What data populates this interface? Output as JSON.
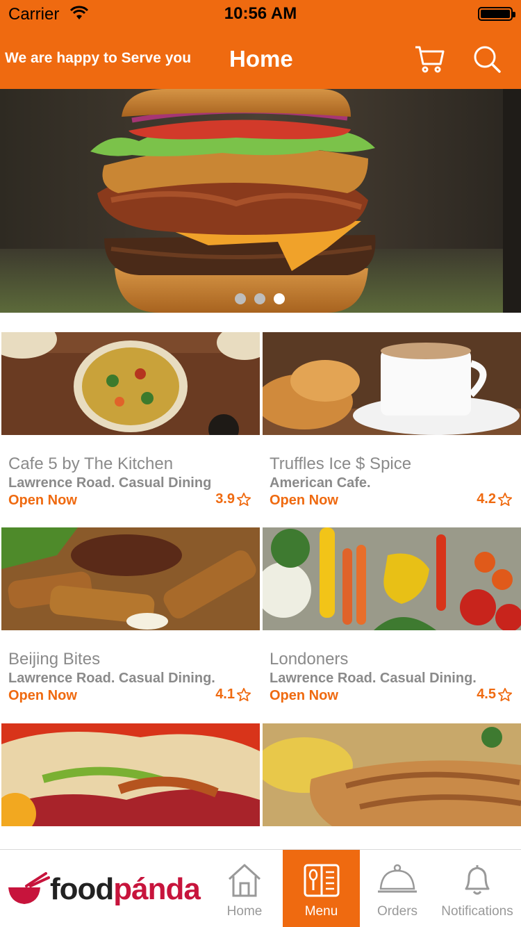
{
  "status_bar": {
    "carrier": "Carrier",
    "time": "10:56 AM"
  },
  "nav": {
    "tagline": "We are happy to Serve you",
    "title": "Home",
    "cart_icon": "cart-icon",
    "search_icon": "search-icon",
    "bg_color": "#ef6a10"
  },
  "banner": {
    "slides": 3,
    "active_slide": 3
  },
  "restaurants": [
    {
      "name": "Cafe 5 by The Kitchen",
      "subtitle": "Lawrence Road. Casual Dining",
      "status": "Open Now",
      "rating": "3.9"
    },
    {
      "name": "Truffles Ice $ Spice",
      "subtitle": "American Cafe.",
      "status": "Open Now",
      "rating": "4.2"
    },
    {
      "name": "Beijing Bites",
      "subtitle": "Lawrence Road. Casual Dining.",
      "status": "Open Now",
      "rating": "4.1"
    },
    {
      "name": "Londoners",
      "subtitle": "Lawrence Road. Casual Dining.",
      "status": "Open Now",
      "rating": "4.5"
    }
  ],
  "tab_bar": {
    "brand": {
      "part1": "food",
      "part2": "pánda"
    },
    "tabs": [
      {
        "label": "Home",
        "icon": "home-icon",
        "active": false
      },
      {
        "label": "Menu",
        "icon": "menu-book-icon",
        "active": true
      },
      {
        "label": "Orders",
        "icon": "cloche-icon",
        "active": false
      },
      {
        "label": "Notifications",
        "icon": "bell-icon",
        "active": false
      }
    ]
  },
  "colors": {
    "accent": "#ef6a10",
    "brand_red": "#c7143c"
  }
}
